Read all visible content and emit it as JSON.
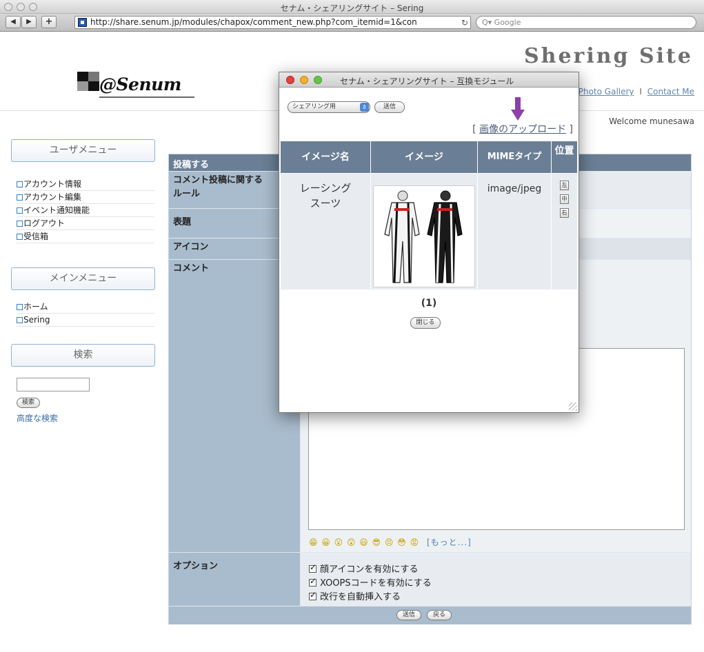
{
  "browser": {
    "window_title": "セナム・シェアリングサイト – Sering",
    "nav_back": "◀",
    "nav_forward": "▶",
    "nav_add": "+",
    "url": "http://share.senum.jp/modules/chapox/comment_new.php?com_itemid=1&con",
    "reload_icon": "↻",
    "search_placeholder": "Q▾ Google"
  },
  "header": {
    "logo_text": "@Senum",
    "site_title": "Shering Site",
    "links": [
      "Photo Gallery",
      "Contact Me"
    ],
    "link_separator": "I",
    "welcome": "Welcome munesawa"
  },
  "sidebar": {
    "user_menu_title": "ユーザメニュー",
    "user_menu": [
      "アカウント情報",
      "アカウント編集",
      "イベント通知機能",
      "ログアウト",
      "受信箱"
    ],
    "main_menu_title": "メインメニュー",
    "main_menu": [
      "ホーム",
      "Sering"
    ],
    "search_title": "検索",
    "search_button": "検索",
    "advanced_search": "高度な検索"
  },
  "form": {
    "header": "投稿する",
    "row_rules_label": "コメント投稿に関する\nルール",
    "row_title_label": "表題",
    "row_icon_label": "アイコン",
    "row_comment_label": "コメント",
    "smileys": "😁 😀 😮 😲 😃 😎 😣 😳 😡",
    "more_link": "[もっと...]",
    "row_options_label": "オプション",
    "options": [
      "顔アイコンを有効にする",
      "XOOPSコードを有効にする",
      "改行を自動挿入する"
    ],
    "submit_button": "送信",
    "back_button": "戻る"
  },
  "popup": {
    "title": "セナム・シェアリングサイト – 互換モジュール",
    "category_select": "シェアリング用",
    "send_button": "送信",
    "upload_link": "画像のアップロード",
    "columns": [
      "イメージ名",
      "イメージ",
      "MIMEタイプ",
      "位置"
    ],
    "row": {
      "name": "レーシング\nスーツ",
      "mime": "image/jpeg",
      "positions": [
        "左",
        "中",
        "右"
      ]
    },
    "pager": "(1)",
    "close_button": "閉じる"
  },
  "colors": {
    "table_header": "#6a7f95",
    "label_cell": "#a9bccd",
    "link_blue": "#5e86b1",
    "arrow_purple": "#8e3fa8"
  }
}
